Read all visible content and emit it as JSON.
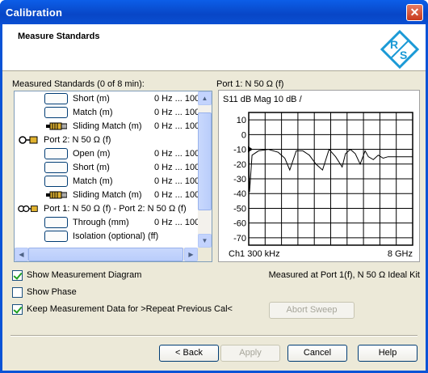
{
  "window": {
    "title": "Calibration",
    "close_glyph": "✕"
  },
  "header": {
    "title": "Measure Standards",
    "logo_icon": "rohde-schwarz-logo",
    "logo_text": "R&S"
  },
  "standards": {
    "label": "Measured Standards (0 of 8 min):",
    "rows": [
      {
        "kind": "std",
        "label": "Short (m)",
        "freq": "0 Hz ... 100"
      },
      {
        "kind": "std",
        "label": "Match (m)",
        "freq": "0 Hz ... 100"
      },
      {
        "kind": "sliding",
        "label": "Sliding Match (m)",
        "freq": "0 Hz ... 100"
      },
      {
        "kind": "port",
        "label": "Port 2: N 50 Ω (f)",
        "freq": ""
      },
      {
        "kind": "std",
        "label": "Open (m)",
        "freq": "0 Hz ... 100"
      },
      {
        "kind": "std",
        "label": "Short (m)",
        "freq": "0 Hz ... 100"
      },
      {
        "kind": "std",
        "label": "Match (m)",
        "freq": "0 Hz ... 100"
      },
      {
        "kind": "sliding",
        "label": "Sliding Match (m)",
        "freq": "0 Hz ... 100"
      },
      {
        "kind": "port2",
        "label": "Port 1: N 50 Ω (f) - Port 2: N 50 Ω (f)",
        "freq": ""
      },
      {
        "kind": "std",
        "label": "Through (mm)",
        "freq": "0 Hz ... 100"
      },
      {
        "kind": "std",
        "label": "Isolation (optional) (ff)",
        "freq": ""
      }
    ]
  },
  "diagram": {
    "port_label": "Port  1: N 50 Ω (f)",
    "title": "S11  dB Mag 10 dB /",
    "footer_left": "Ch1  300 kHz",
    "footer_right": "8 GHz"
  },
  "chart_data": {
    "type": "line",
    "title": "S11  dB Mag 10 dB /",
    "ylim": [
      -75,
      15
    ],
    "yticks": [
      10,
      0,
      -10,
      -20,
      -30,
      -40,
      -50,
      -60,
      -70
    ],
    "xlim": [
      0,
      10
    ],
    "xlabel": "",
    "ylabel": "",
    "grid": true,
    "series": [
      {
        "x": [
          0,
          0.05,
          0.2,
          0.6,
          1.2,
          1.8,
          2.2,
          2.5,
          2.9,
          3.3,
          3.7,
          4.1,
          4.5,
          4.9,
          5.3,
          5.7,
          5.9,
          6.2,
          6.5,
          6.8,
          7.1,
          7.3,
          7.6,
          7.9,
          8.2,
          8.5,
          9,
          10
        ],
        "y": [
          -10,
          -39,
          -14,
          -11,
          -10,
          -12,
          -16,
          -24,
          -11,
          -11,
          -14,
          -20,
          -24,
          -10,
          -15,
          -22,
          -13,
          -10,
          -13,
          -20,
          -11,
          -15,
          -17,
          -14,
          -16,
          -15,
          -15,
          -15
        ]
      }
    ]
  },
  "options": {
    "show_diagram": {
      "label": "Show Measurement Diagram",
      "checked": true
    },
    "show_phase": {
      "label": "Show Phase",
      "checked": false
    },
    "keep_data": {
      "label": "Keep Measurement Data for >Repeat Previous Cal<",
      "checked": true
    }
  },
  "measured_at": "Measured at Port 1(f), N 50 Ω Ideal Kit",
  "buttons": {
    "abort": "Abort Sweep",
    "back": "< Back",
    "apply": "Apply",
    "cancel": "Cancel",
    "help": "Help"
  },
  "colors": {
    "titlebar": "#0a53d6",
    "dialog": "#ece9d8",
    "trace": "#000000",
    "logo": "#1b9ad6"
  }
}
